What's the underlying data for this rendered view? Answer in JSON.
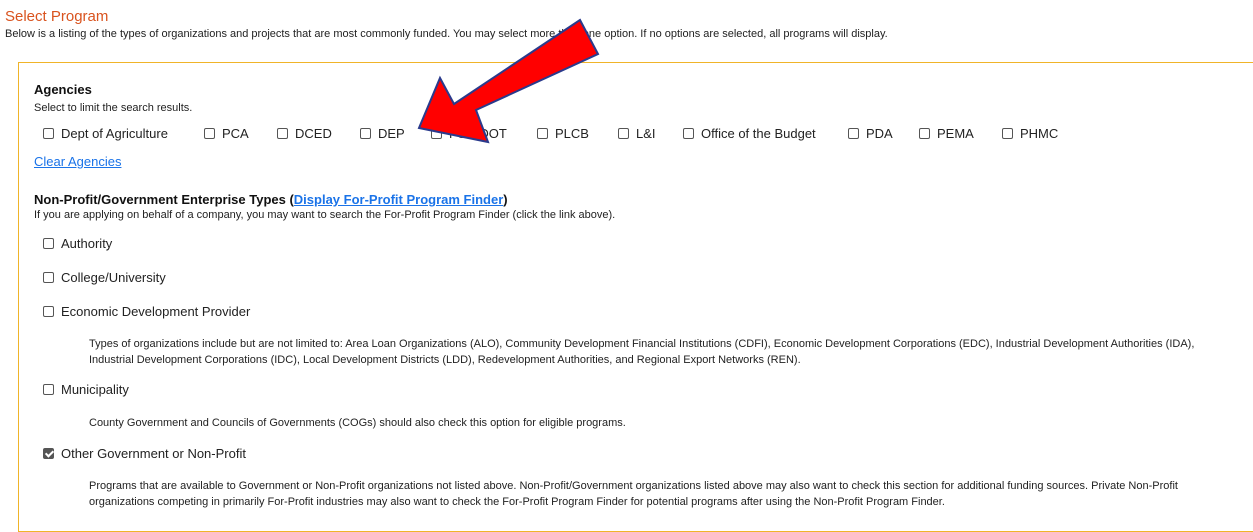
{
  "header": {
    "title": "Select Program",
    "intro": "Below is a listing of the types of organizations and projects that are most commonly funded.  You may select more than one option.  If no options are selected, all programs will display."
  },
  "agencies": {
    "title": "Agencies",
    "subtitle": "Select to limit the search results.",
    "options": [
      {
        "label": "Dept of Agriculture",
        "checked": false
      },
      {
        "label": "PCA",
        "checked": false
      },
      {
        "label": "DCED",
        "checked": false
      },
      {
        "label": "DEP",
        "checked": false
      },
      {
        "label": "PennDOT",
        "checked": false
      },
      {
        "label": "PLCB",
        "checked": false
      },
      {
        "label": "L&I",
        "checked": false
      },
      {
        "label": "Office of the Budget",
        "checked": false
      },
      {
        "label": "PDA",
        "checked": false
      },
      {
        "label": "PEMA",
        "checked": false
      },
      {
        "label": "PHMC",
        "checked": false
      }
    ],
    "clear_label": "Clear Agencies"
  },
  "enterprise": {
    "title": "Non-Profit/Government Enterprise Types (",
    "link_label": "Display For-Profit Program Finder",
    "title_close": ")",
    "subtitle": "If you are applying on behalf of a company, you may want to search the For-Profit Program Finder (click the link above).",
    "types": [
      {
        "label": "Authority",
        "checked": false,
        "description": ""
      },
      {
        "label": "College/University",
        "checked": false,
        "description": ""
      },
      {
        "label": "Economic Development Provider",
        "checked": false,
        "description": "Types of organizations include but are not limited to: Area Loan Organizations (ALO), Community Development Financial Institutions (CDFI), Economic Development Corporations (EDC), Industrial Development Authorities (IDA), Industrial Development Corporations (IDC), Local Development Districts (LDD), Redevelopment Authorities, and Regional Export Networks (REN)."
      },
      {
        "label": "Municipality",
        "checked": false,
        "description": "County Government and Councils of Governments (COGs) should also check this option for eligible programs."
      },
      {
        "label": "Other Government or Non-Profit",
        "checked": true,
        "description": "Programs that are available to Government or Non-Profit organizations not listed above.  Non-Profit/Government organizations listed above may also want to check this section for additional funding sources.  Private Non-Profit organizations competing in primarily For-Profit industries may also want to check the For-Profit Program Finder for potential programs after using the Non-Profit Program Finder."
      }
    ]
  },
  "colors": {
    "accent_title": "#d9531e",
    "panel_border": "#f0b429",
    "link": "#1a73e8",
    "arrow_fill": "#ff0000",
    "arrow_stroke": "#2a3a8c"
  }
}
